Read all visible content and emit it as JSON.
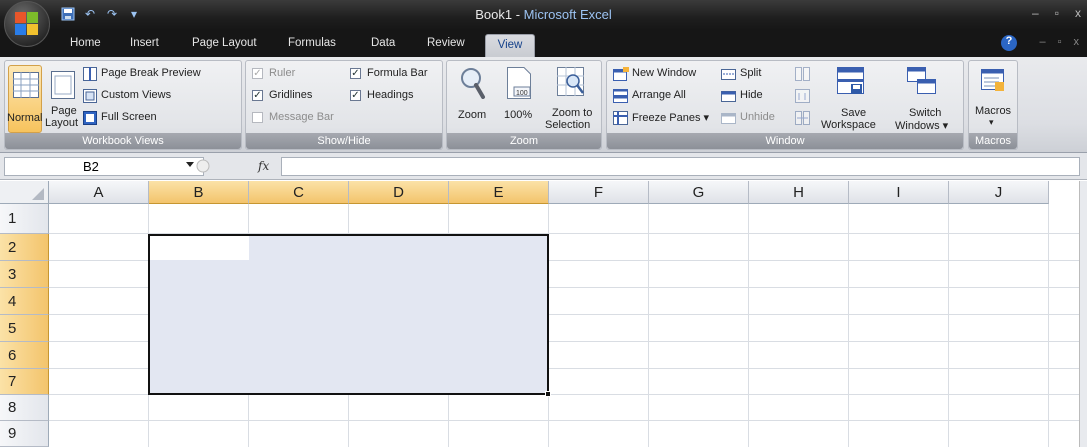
{
  "window": {
    "title_doc": "Book1",
    "title_sep": " - ",
    "title_app": "Microsoft Excel",
    "controls": [
      "–",
      "▫",
      "x"
    ]
  },
  "quick_access": [
    "save-icon",
    "undo-icon",
    "redo-icon",
    "customize-icon"
  ],
  "tabs": [
    "Home",
    "Insert",
    "Page Layout",
    "Formulas",
    "Data",
    "Review",
    "View"
  ],
  "active_tab": "View",
  "doc_controls": [
    "–",
    "▫",
    "x"
  ],
  "ribbon": {
    "workbook_views": {
      "label": "Workbook Views",
      "normal": "Normal",
      "page_layout_1": "Page",
      "page_layout_2": "Layout",
      "page_break_preview": "Page Break Preview",
      "custom_views": "Custom Views",
      "full_screen": "Full Screen"
    },
    "show_hide": {
      "label": "Show/Hide",
      "ruler": "Ruler",
      "formula_bar": "Formula Bar",
      "gridlines": "Gridlines",
      "headings": "Headings",
      "message_bar": "Message Bar",
      "ruler_checked": true,
      "formula_bar_checked": true,
      "gridlines_checked": true,
      "headings_checked": true,
      "message_bar_checked": false
    },
    "zoom": {
      "label": "Zoom",
      "zoom": "Zoom",
      "hundred": "100%",
      "hundred_icon_text": "100",
      "zoom_to_1": "Zoom to",
      "zoom_to_2": "Selection"
    },
    "window": {
      "label": "Window",
      "new_window": "New Window",
      "arrange_all": "Arrange All",
      "freeze_panes": "Freeze Panes ▾",
      "split": "Split",
      "hide": "Hide",
      "unhide": "Unhide",
      "save_workspace_1": "Save",
      "save_workspace_2": "Workspace",
      "switch_windows_1": "Switch",
      "switch_windows_2": "Windows ▾"
    },
    "macros": {
      "label": "Macros",
      "macros": "Macros",
      "dropdown": "▾"
    }
  },
  "formula_bar": {
    "name_box": "B2",
    "fx": "fx",
    "formula": ""
  },
  "sheet": {
    "columns": [
      "A",
      "B",
      "C",
      "D",
      "E",
      "F",
      "G",
      "H",
      "I",
      "J"
    ],
    "rows": [
      "1",
      "2",
      "3",
      "4",
      "5",
      "6",
      "7",
      "8",
      "9"
    ],
    "selection": "B2:E7",
    "active_cell": "B2"
  }
}
